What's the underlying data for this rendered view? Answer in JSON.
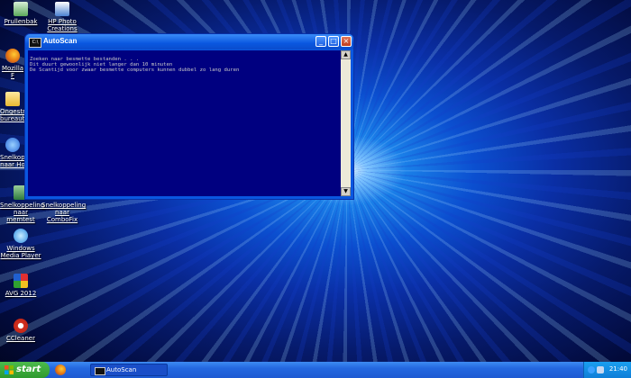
{
  "desktop": {
    "icons": [
      {
        "label": "Prullenbak"
      },
      {
        "label": "HP Photo Creations"
      },
      {
        "label": "Mozilla F"
      },
      {
        "label": "Ongestr bureaubl"
      },
      {
        "label": "Snelkoppe naar Ho"
      },
      {
        "label": "Snelkoppeling naar memtest"
      },
      {
        "label": "Snelkoppeling naar ComboFix"
      },
      {
        "label": "Windows Media Player"
      },
      {
        "label": "AVG 2012"
      },
      {
        "label": "CCleaner"
      }
    ]
  },
  "window": {
    "title": "AutoScan",
    "icon_text": "C:\\",
    "console_lines": [
      "Zoeken naar besmette bestanden . . .",
      "Dit duurt gewoonlijk niet langer dan 10 minuten",
      "De Scantijd voor zwaar besmette computers kunnen dubbel zo lang duren"
    ],
    "console_bg": "#000080"
  },
  "taskbar": {
    "start_label": "start",
    "task_label": "AutoScan",
    "clock": "21:40"
  },
  "colors": {
    "taskbar": "#2468e0",
    "start": "#2e9a2e",
    "title": "#0a57e0"
  }
}
